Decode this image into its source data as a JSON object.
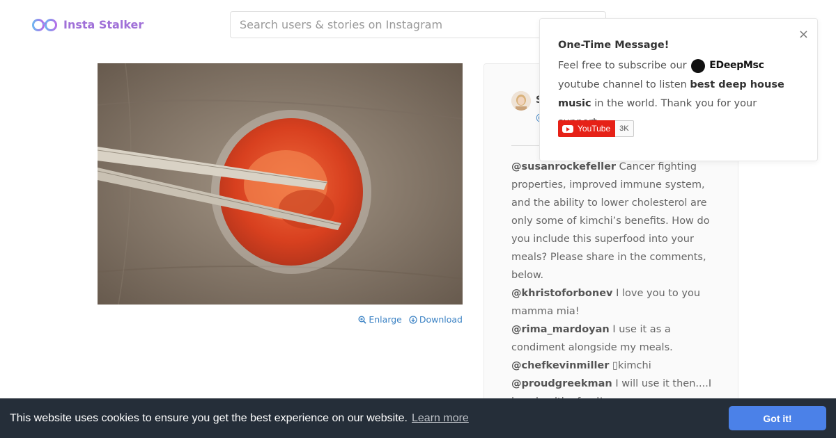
{
  "header": {
    "logo_text": "Insta Stalker",
    "search_placeholder": "Search users & stories on Instagram"
  },
  "photo_actions": {
    "enlarge": "Enlarge",
    "download": "Download"
  },
  "panel": {
    "user_initial": "S",
    "user_sub": "@"
  },
  "comments": [
    {
      "user": "@susanrockefeller",
      "text": " Cancer fighting properties, improved immune system, and the ability to lower cholesterol are only some of kimchi’s benefits. How do you include this superfood into your meals? Please share in the comments, below."
    },
    {
      "user": "@khristoforbonev",
      "text": " I love you to you mamma mia!"
    },
    {
      "user": "@rima_mardoyan",
      "text": " I use it as a condiment alongside my meals."
    },
    {
      "user": "@chefkevinmiller",
      "text": " ▯kimchi"
    },
    {
      "user": "@proudgreekman",
      "text": " I will use it then....I love healthy food!"
    },
    {
      "user": "@",
      "text": ""
    }
  ],
  "popup": {
    "title": "One-Time Message!",
    "body_prefix": "Feel free to subscribe our",
    "brand": "EDeepMsc",
    "body_mid": "youtube channel to listen",
    "body_bold": "best deep house music",
    "body_suffix": "in the world. Thank you for your support.",
    "close": "×",
    "youtube_label": "YouTube",
    "youtube_count": "3K"
  },
  "cookie": {
    "text": "This website uses cookies to ensure you get the best experience on our website.",
    "link": "Learn more",
    "button": "Got it!"
  },
  "colors": {
    "logo": "#a070d8",
    "link": "#3b82c4",
    "cookie_bg": "#252e39",
    "cookie_button": "#4b81e8",
    "youtube_red": "#e62117"
  }
}
